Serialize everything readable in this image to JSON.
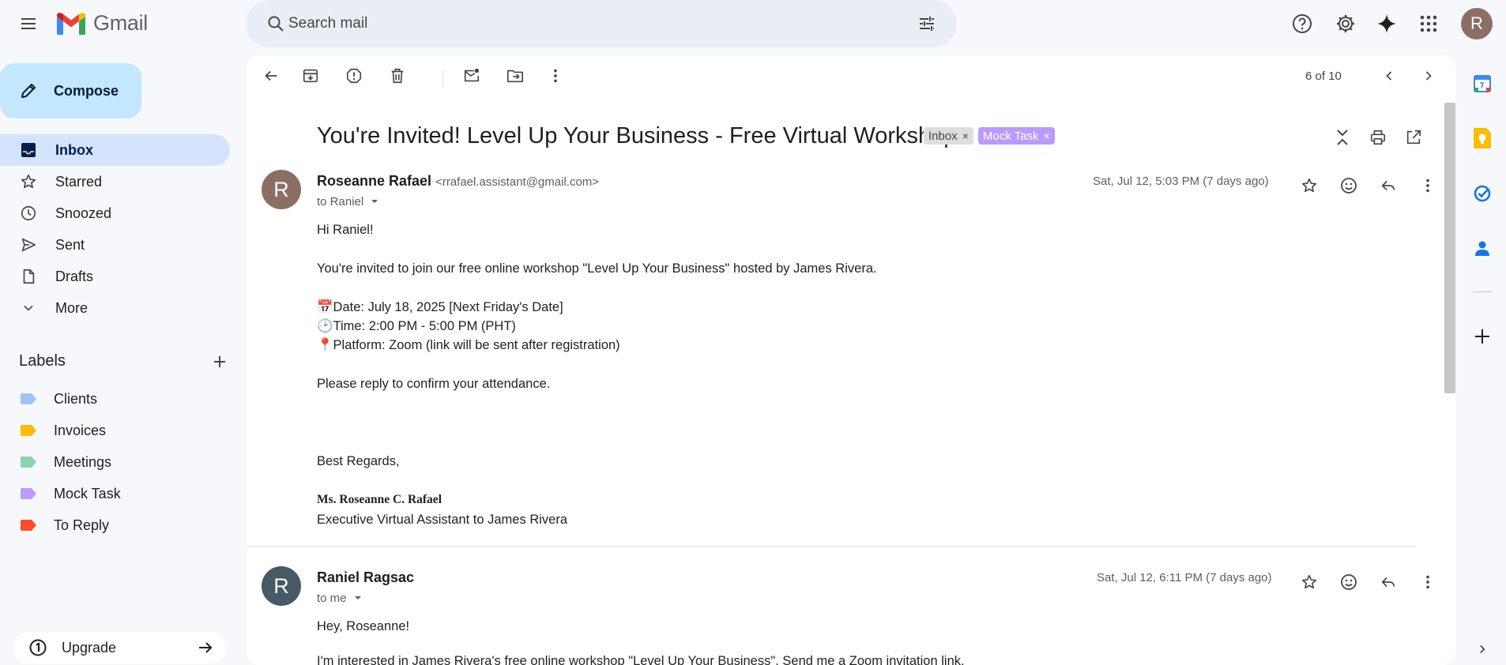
{
  "app": {
    "name": "Gmail",
    "account_initial": "R"
  },
  "search": {
    "placeholder": "Search mail"
  },
  "compose": {
    "label": "Compose"
  },
  "nav": {
    "items": [
      {
        "label": "Inbox",
        "icon": "inbox-icon",
        "active": true
      },
      {
        "label": "Starred",
        "icon": "star-icon"
      },
      {
        "label": "Snoozed",
        "icon": "clock-icon"
      },
      {
        "label": "Sent",
        "icon": "send-icon"
      },
      {
        "label": "Drafts",
        "icon": "draft-icon"
      },
      {
        "label": "More",
        "icon": "chevron-down-icon"
      }
    ]
  },
  "labels": {
    "title": "Labels",
    "items": [
      {
        "label": "Clients",
        "color": "#a4c2f4"
      },
      {
        "label": "Invoices",
        "color": "#fbbc04"
      },
      {
        "label": "Meetings",
        "color": "#89d3b2"
      },
      {
        "label": "Mock Task",
        "color": "#b99aff"
      },
      {
        "label": "To Reply",
        "color": "#fb4c2f"
      }
    ]
  },
  "upgrade": {
    "label": "Upgrade"
  },
  "toolbar": {
    "page_count": "6 of 10"
  },
  "thread": {
    "subject": "You're Invited! Level Up Your Business - Free Virtual Workshop",
    "tags": [
      {
        "label": "Inbox",
        "remove": "×"
      },
      {
        "label": "Mock Task",
        "remove": "×"
      }
    ],
    "messages": [
      {
        "initial": "R",
        "avatar_color": "#8d6e63",
        "sender": "Roseanne Rafael",
        "email": "<rrafael.assistant@gmail.com>",
        "to": "to Raniel",
        "date": "Sat, Jul 12, 5:03 PM (7 days ago)",
        "greeting": "Hi Raniel!",
        "intro": "You're invited to join our free online workshop \"Level Up Your Business\" hosted by James Rivera.",
        "date_line": "📅Date: July 18, 2025 [Next Friday's Date]",
        "time_line": "🕑Time: 2:00 PM - 5:00 PM (PHT)",
        "platform_line": "📍Platform: Zoom (link will be sent after registration)",
        "cta": "Please reply to confirm your attendance.",
        "closing": "Best Regards,",
        "sig_name": "Ms. Roseanne C. Rafael",
        "sig_title": "Executive Virtual Assistant to James Rivera"
      },
      {
        "initial": "R",
        "avatar_color": "#455a64",
        "sender": "Raniel Ragsac",
        "to": "to me",
        "date": "Sat, Jul 12, 6:11 PM (7 days ago)",
        "greeting": "Hey, Roseanne!",
        "intro": "I'm interested in James Rivera's free online workshop \"Level Up Your Business\". Send me a Zoom invitation link."
      }
    ]
  }
}
